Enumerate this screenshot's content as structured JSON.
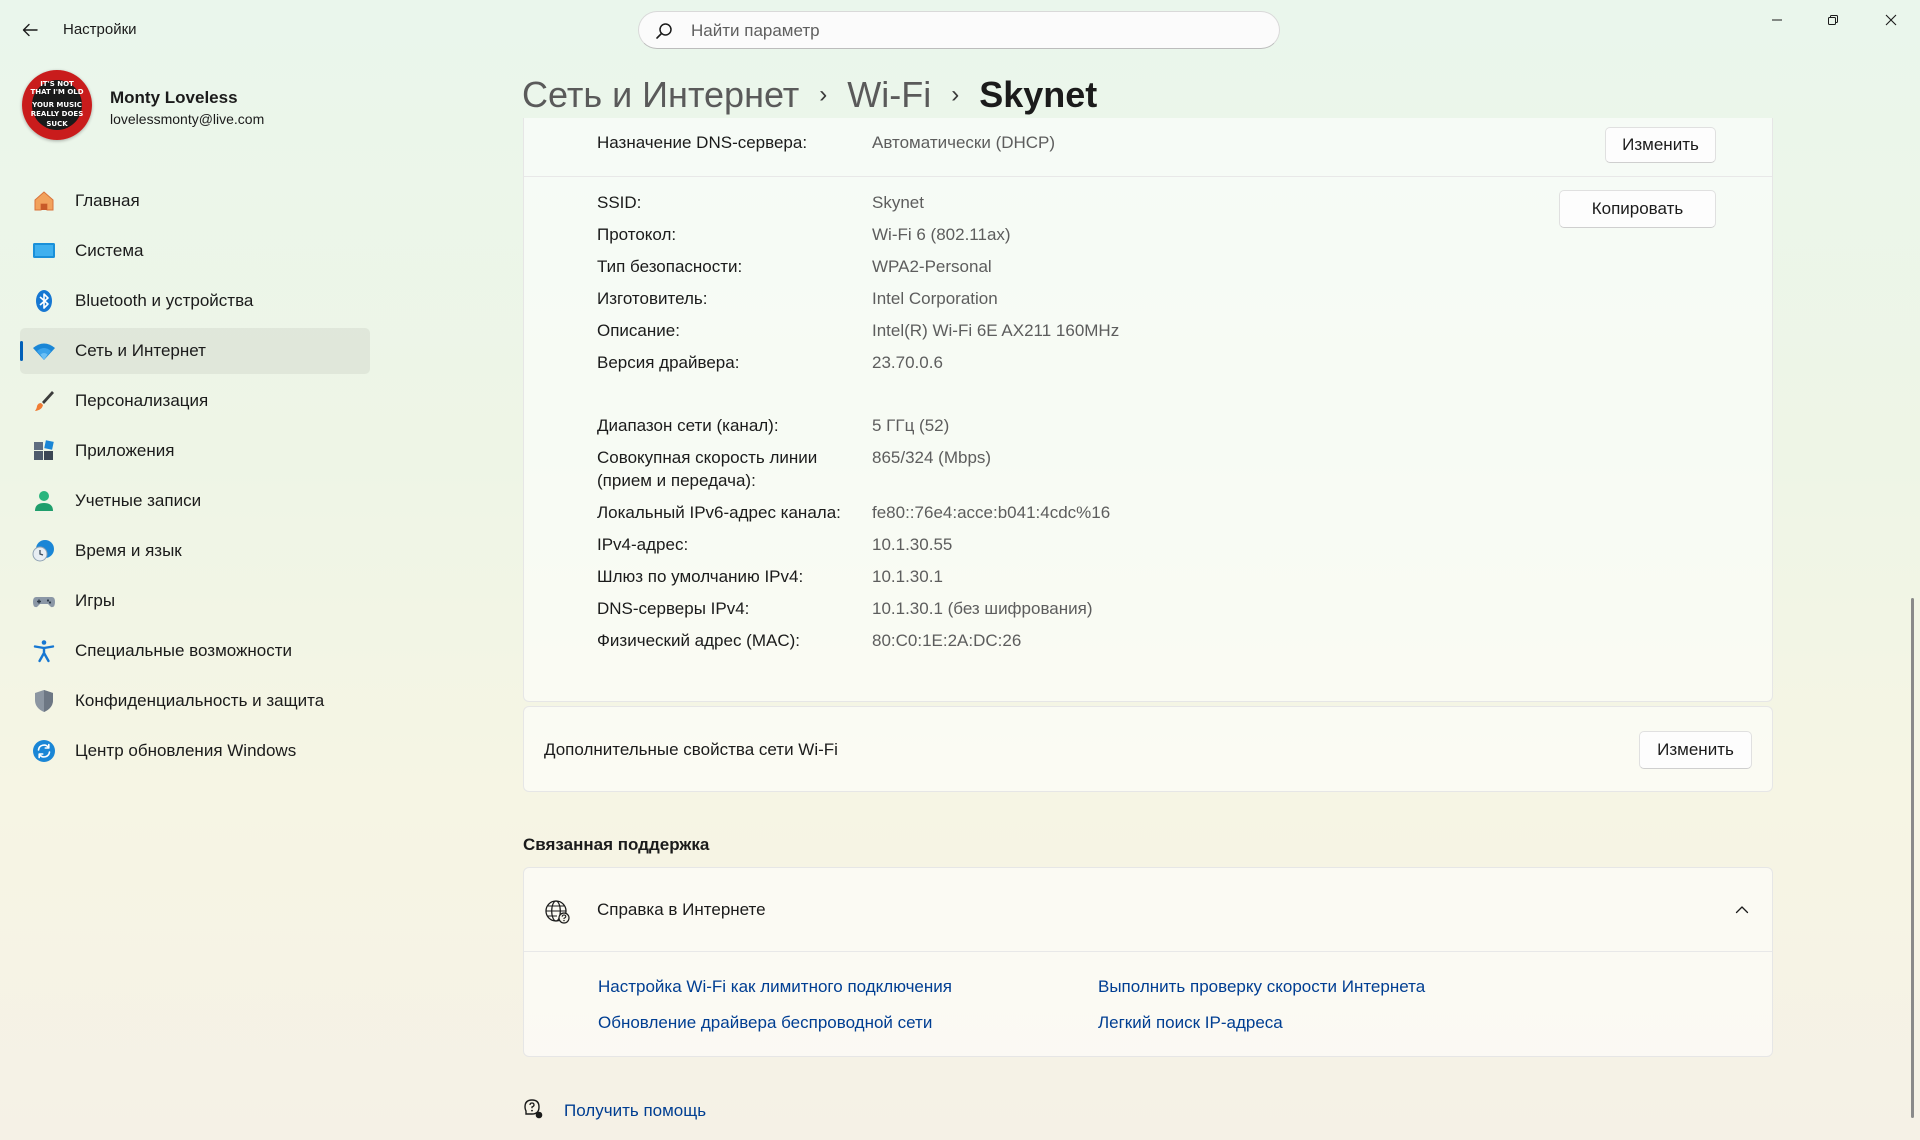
{
  "app": {
    "title": "Настройки"
  },
  "search": {
    "placeholder": "Найти параметр"
  },
  "profile": {
    "name": "Monty Loveless",
    "email": "lovelessmonty@live.com",
    "avatar_text": [
      "IT'S NOT",
      "THAT I'M OLD",
      "YOUR MUSIC",
      "REALLY DOES",
      "SUCK"
    ]
  },
  "sidebar": {
    "items": [
      {
        "label": "Главная",
        "icon": "home-icon"
      },
      {
        "label": "Система",
        "icon": "system-icon"
      },
      {
        "label": "Bluetooth и устройства",
        "icon": "bluetooth-icon"
      },
      {
        "label": "Сеть и Интернет",
        "icon": "wifi-icon",
        "active": true
      },
      {
        "label": "Персонализация",
        "icon": "brush-icon"
      },
      {
        "label": "Приложения",
        "icon": "apps-icon"
      },
      {
        "label": "Учетные записи",
        "icon": "person-icon"
      },
      {
        "label": "Время и язык",
        "icon": "clock-globe-icon"
      },
      {
        "label": "Игры",
        "icon": "gamepad-icon"
      },
      {
        "label": "Специальные возможности",
        "icon": "accessibility-icon"
      },
      {
        "label": "Конфиденциальность и защита",
        "icon": "shield-icon"
      },
      {
        "label": "Центр обновления Windows",
        "icon": "update-icon"
      }
    ]
  },
  "breadcrumb": [
    "Сеть и Интернет",
    "Wi-Fi",
    "Skynet"
  ],
  "dns_assignment": {
    "label": "Назначение DNS-сервера:",
    "value": "Автоматически (DHCP)",
    "button": "Изменить"
  },
  "properties": {
    "copy_button": "Копировать",
    "group1": [
      {
        "label": "SSID:",
        "value": "Skynet"
      },
      {
        "label": "Протокол:",
        "value": "Wi-Fi 6 (802.11ax)"
      },
      {
        "label": "Тип безопасности:",
        "value": "WPA2-Personal"
      },
      {
        "label": "Изготовитель:",
        "value": "Intel Corporation"
      },
      {
        "label": "Описание:",
        "value": "Intel(R) Wi-Fi 6E AX211 160MHz"
      },
      {
        "label": "Версия драйвера:",
        "value": "23.70.0.6"
      }
    ],
    "group2": [
      {
        "label": "Диапазон сети (канал):",
        "value": "5 ГГц (52)"
      },
      {
        "label": "Совокупная скорость линии",
        "label2": "(прием и передача):",
        "value": "865/324 (Mbps)"
      },
      {
        "label": "Локальный IPv6-адрес канала:",
        "value": "fe80::76e4:acce:b041:4cdc%16"
      },
      {
        "label": "IPv4-адрес:",
        "value": "10.1.30.55"
      },
      {
        "label": "Шлюз по умолчанию IPv4:",
        "value": "10.1.30.1"
      },
      {
        "label": "DNS-серверы IPv4:",
        "value": "10.1.30.1 (без шифрования)"
      },
      {
        "label": "Физический адрес (MAC):",
        "value": "80:C0:1E:2A:DC:26"
      }
    ]
  },
  "wifi_extra": {
    "label": "Дополнительные свойства сети Wi-Fi",
    "button": "Изменить"
  },
  "related_support": {
    "title": "Связанная поддержка",
    "card_title": "Справка в Интернете",
    "links": [
      "Настройка Wi-Fi как лимитного подключения",
      "Выполнить проверку скорости Интернета",
      "Обновление драйвера беспроводной сети",
      "Легкий поиск IP-адреса"
    ]
  },
  "get_help": "Получить помощь"
}
